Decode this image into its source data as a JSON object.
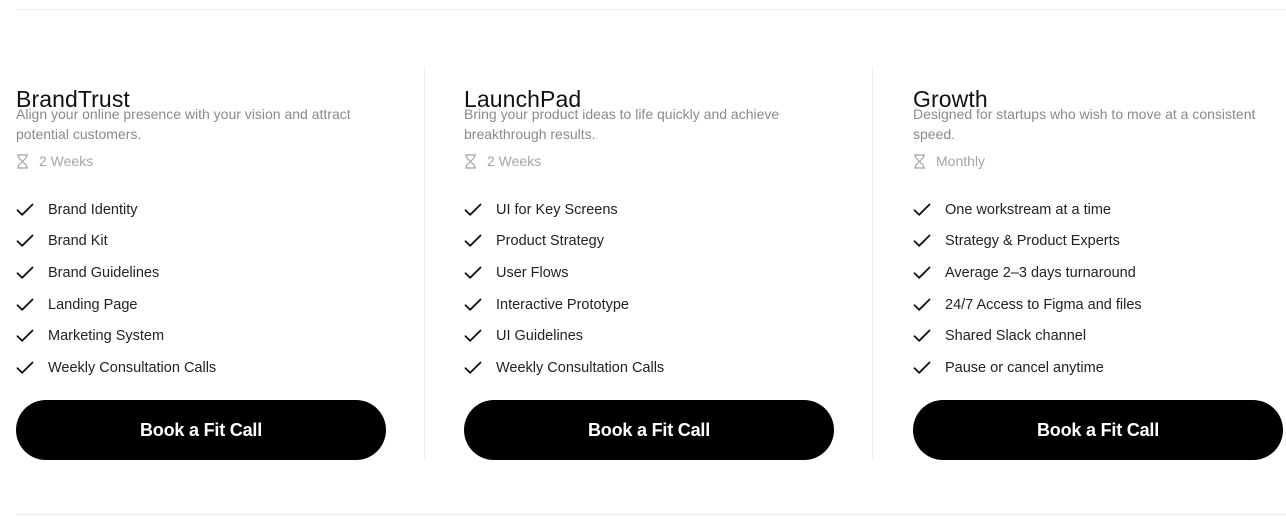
{
  "plans": [
    {
      "title": "BrandTrust",
      "description": "Align your online presence with your vision and attract potential customers.",
      "duration": "2 Weeks",
      "features": [
        "Brand Identity",
        "Brand Kit",
        "Brand Guidelines",
        "Landing Page",
        "Marketing System",
        "Weekly Consultation Calls"
      ],
      "cta_label": "Book a Fit Call"
    },
    {
      "title": "LaunchPad",
      "description": "Bring your product ideas to life quickly and achieve breakthrough results.",
      "duration": "2 Weeks",
      "features": [
        "UI for Key Screens",
        "Product Strategy",
        "User Flows",
        "Interactive Prototype",
        "UI Guidelines",
        "Weekly Consultation Calls"
      ],
      "cta_label": "Book a Fit Call"
    },
    {
      "title": "Growth",
      "description": "Designed for startups who wish to move at a consistent speed.",
      "duration": "Monthly",
      "features": [
        "One workstream at a time",
        "Strategy & Product Experts",
        "Average 2–3 days turnaround",
        "24/7 Access to Figma and files",
        "Shared Slack channel",
        "Pause or cancel anytime"
      ],
      "cta_label": "Book a Fit Call"
    }
  ],
  "icons": {
    "duration": "hourglass-icon",
    "feature": "checkmark-icon"
  },
  "colors": {
    "button_bg": "#000000",
    "button_text": "#ffffff",
    "description_text": "#8a8a8a",
    "duration_text": "#a5a5a5"
  }
}
